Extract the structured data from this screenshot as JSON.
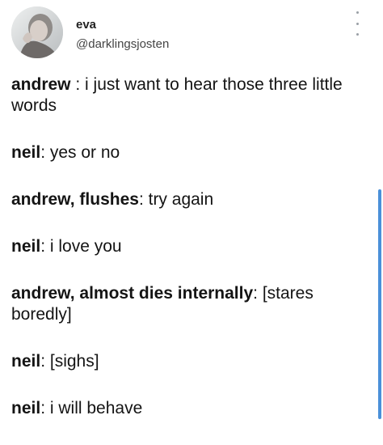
{
  "post": {
    "author_name": "eva",
    "author_handle": "@darklingsjosten",
    "more_icon": "vertical-ellipsis-icon",
    "lines": [
      {
        "speaker": "andrew",
        "sep": " : ",
        "text": "i just want to hear those three little words"
      },
      {
        "speaker": "neil",
        "sep": ": ",
        "text": "yes or no"
      },
      {
        "speaker": "andrew, flushes",
        "sep": ": ",
        "text": "try again"
      },
      {
        "speaker": "neil",
        "sep": ": ",
        "text": "i love you"
      },
      {
        "speaker": "andrew, almost dies internally",
        "sep": ": ",
        "text": "[stares boredly]"
      },
      {
        "speaker": "neil",
        "sep": ": ",
        "text": "[sighs]"
      },
      {
        "speaker": "neil",
        "sep": ": ",
        "text": "i will behave"
      }
    ]
  },
  "colors": {
    "text": "#141414",
    "scrollbar": "#4a90d9"
  }
}
